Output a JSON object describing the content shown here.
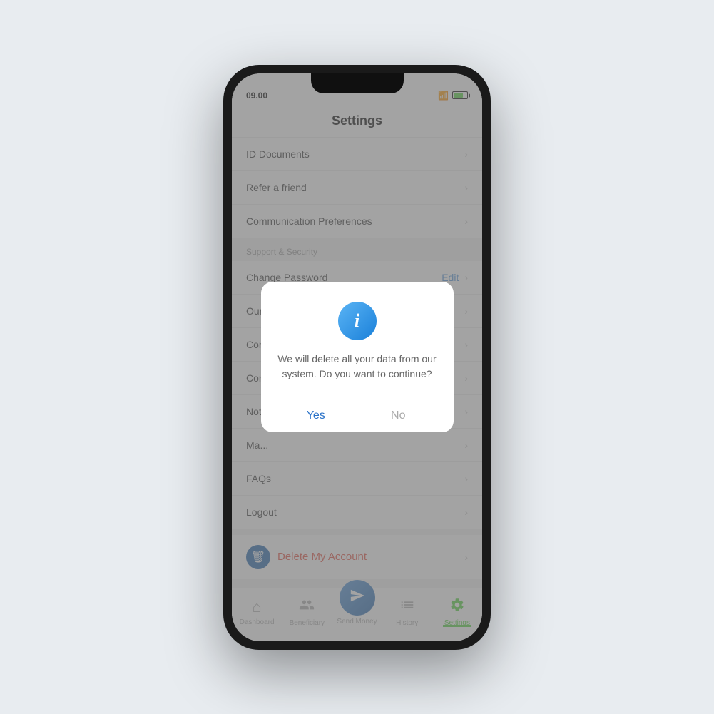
{
  "phone": {
    "status": {
      "time": "09.00",
      "wifi": "wifi",
      "battery_level": 70
    },
    "header": {
      "title": "Settings"
    },
    "settings": {
      "items_top": [
        {
          "label": "ID Documents",
          "chevron": "›"
        },
        {
          "label": "Refer a friend",
          "chevron": "›"
        },
        {
          "label": "Communication Preferences",
          "chevron": "›"
        }
      ],
      "section_support": "Support & Security",
      "items_support": [
        {
          "label": "Change Password",
          "edit": "Edit",
          "chevron": "›"
        },
        {
          "label": "Our...",
          "chevron": "›"
        },
        {
          "label": "Con...",
          "chevron": "›"
        },
        {
          "label": "Con...",
          "chevron": "›"
        },
        {
          "label": "Not...",
          "chevron": "›"
        },
        {
          "label": "Ma...",
          "chevron": "›"
        },
        {
          "label": "FAQs",
          "chevron": "›"
        },
        {
          "label": "Logout",
          "chevron": "›"
        }
      ],
      "delete_account": {
        "label": "Delete My Account",
        "chevron": "›"
      }
    },
    "dialog": {
      "message": "We will delete all your data from our system. Do you want to continue?",
      "yes_label": "Yes",
      "no_label": "No"
    },
    "bottom_nav": {
      "items": [
        {
          "id": "dashboard",
          "label": "Dashboard",
          "icon": "⌂",
          "active": false
        },
        {
          "id": "beneficiary",
          "label": "Beneficiary",
          "icon": "👥",
          "active": false
        },
        {
          "id": "send_money",
          "label": "Send Money",
          "icon": "➤",
          "active": false,
          "special": true
        },
        {
          "id": "history",
          "label": "History",
          "icon": "☰",
          "active": false
        },
        {
          "id": "settings",
          "label": "Settings",
          "icon": "⚙",
          "active": true
        }
      ]
    }
  }
}
